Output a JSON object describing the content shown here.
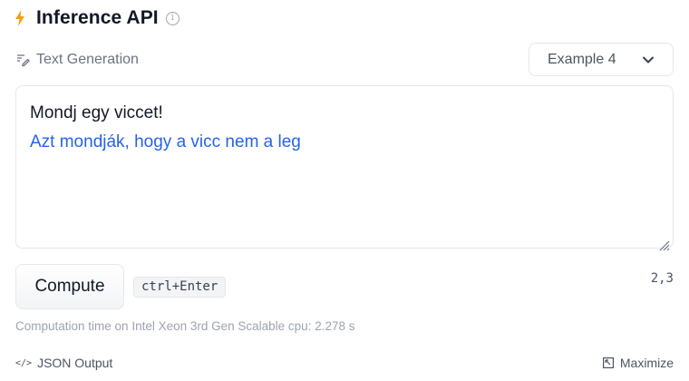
{
  "header": {
    "title": "Inference API",
    "bolt_icon": "lightning-bolt-icon",
    "info_icon": "info-icon",
    "info_glyph": "i",
    "accent_color": "#f59e0b"
  },
  "task": {
    "label": "Text Generation",
    "icon": "text-generation-icon"
  },
  "example_select": {
    "selected": "Example 4"
  },
  "editor": {
    "prompt": "Mondj egy viccet!",
    "completion": "Azt mondják, hogy a vicc nem a leg",
    "completion_color": "#2563eb"
  },
  "actions": {
    "compute_label": "Compute",
    "shortcut": "ctrl+Enter",
    "counter": "2,3"
  },
  "status": {
    "computation_time": "Computation time on Intel Xeon 3rd Gen Scalable cpu: 2.278 s"
  },
  "footer": {
    "json_output_label": "JSON Output",
    "json_icon": "</>",
    "maximize_label": "Maximize"
  }
}
